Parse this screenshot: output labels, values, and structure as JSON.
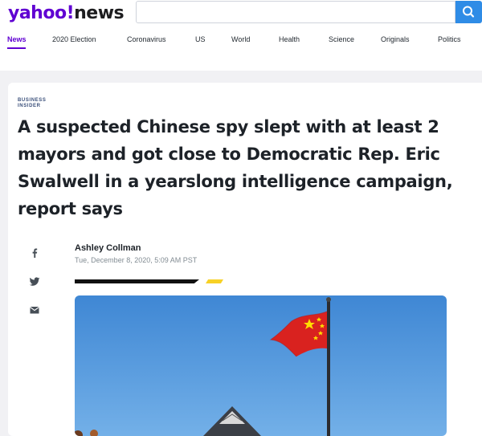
{
  "brand": {
    "logo_yahoo": "yahoo!",
    "logo_news": "news",
    "brand_color": "#6001d2"
  },
  "search": {
    "button_icon": "search-icon"
  },
  "nav": {
    "items": [
      {
        "label": "News",
        "active": true
      },
      {
        "label": "2020 Election"
      },
      {
        "label": "Coronavirus"
      },
      {
        "label": "US"
      },
      {
        "label": "World"
      },
      {
        "label": "Health"
      },
      {
        "label": "Science"
      },
      {
        "label": "Originals"
      },
      {
        "label": "Politics"
      }
    ]
  },
  "article": {
    "source_line1": "BUSINESS",
    "source_line2": "INSIDER",
    "headline": "A suspected Chinese spy slept with at least 2 mayors and got close to Democratic Rep. Eric Swalwell in a yearslong intelligence campaign, report says",
    "author": "Ashley Collman",
    "date": "Tue, December 8, 2020, 5:09 AM PST",
    "share_icons": [
      "facebook-icon",
      "twitter-icon",
      "mail-icon"
    ],
    "accent_colors": {
      "rule_black": "#111111",
      "rule_yellow": "#f7d126"
    }
  }
}
